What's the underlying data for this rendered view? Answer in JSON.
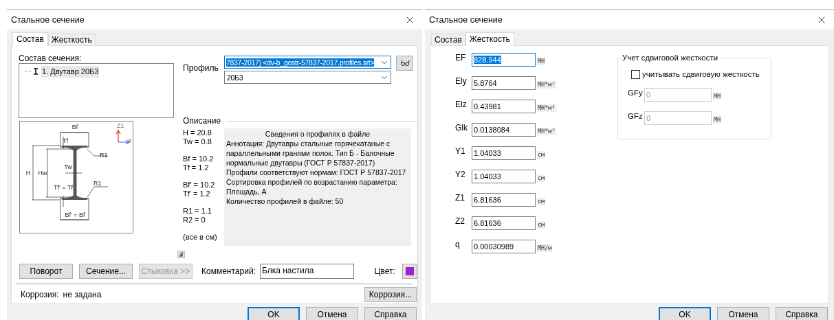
{
  "composition_dialog": {
    "title": "Стальное сечение",
    "tabs": [
      {
        "label": "Состав",
        "selected": true
      },
      {
        "label": "Жесткость",
        "selected": false
      }
    ],
    "section_label": "Состав сечения:",
    "tree": [
      {
        "label": "1. Двутавр 20Б3",
        "selected": true
      }
    ],
    "profile_label": "Профиль",
    "profile_file": {
      "value": "7837-2017) <dv-b_gostr-57837-2017.profiles.srt>",
      "focused": true
    },
    "profile_size": {
      "value": "20Б3",
      "focused": false
    },
    "drawing_labels": [
      {
        "text": "Bf"
      },
      {
        "text": "Tf"
      },
      {
        "text": "R1"
      },
      {
        "text": "H"
      },
      {
        "text": "Hw"
      },
      {
        "text": "Tw"
      },
      {
        "text": "Tf' = Tf"
      },
      {
        "text": "R1"
      },
      {
        "text": "Bf' = Bf"
      },
      {
        "text": "Z1"
      },
      {
        "text": "Y"
      }
    ],
    "description_label": "Описание",
    "param_groups": [
      [
        "H = 20.8",
        "Tw = 0.8"
      ],
      [
        "Bf = 10.2",
        "Tf = 1.2"
      ],
      [
        "Bf' = 10.2",
        "Tf' = 1.2"
      ],
      [
        "R1 = 1.1",
        "R2 = 0"
      ],
      [
        "(все в см)"
      ]
    ],
    "info": {
      "title": "Сведения о профилях в файле",
      "lines": [
        "Аннотация: Двутавры стальные горячекатаные с параллельными гранями полок. Тип Б - Балочные нормальные двутавры (ГОСТ Р 57837-2017)",
        "Профили соответствуют нормам: ГОСТ Р 57837-2017",
        "Сортировка профилей по возрастанию параметра: Площадь, А",
        "Количество профилей в файле: 50"
      ]
    },
    "action_buttons": [
      {
        "label": "Поворот",
        "disabled": false
      },
      {
        "label": "Сечение...",
        "disabled": false
      },
      {
        "label": "Стыковка >>",
        "disabled": true
      }
    ],
    "comment_label": "Комментарий:",
    "comment_value": "Блка настила",
    "color_label": "Цвет:",
    "color": "#a31fd0",
    "corrosion_label": "Коррозия:",
    "corrosion_value": "не задана",
    "corrosion_button": "Коррозия...",
    "footer_buttons": [
      {
        "label": "OK",
        "default": true
      },
      {
        "label": "Отмена",
        "default": false
      },
      {
        "label": "Справка",
        "default": false
      }
    ]
  },
  "stiffness_dialog": {
    "title": "Стальное сечение",
    "tabs": [
      {
        "label": "Состав",
        "selected": false
      },
      {
        "label": "Жесткость",
        "selected": true
      }
    ],
    "rows": [
      {
        "label": "EF",
        "value": "828.944",
        "unit": "МН",
        "focused": true
      },
      {
        "label": "Ely",
        "value": "5.8764",
        "unit": "МН*м²",
        "focused": false
      },
      {
        "label": "Elz",
        "value": "0.43981",
        "unit": "МН*м²",
        "focused": false
      },
      {
        "label": "Glk",
        "value": "0.0138084",
        "unit": "МН*м²",
        "focused": false
      },
      {
        "label": "Y1",
        "value": "1.04033",
        "unit": "см",
        "focused": false
      },
      {
        "label": "Y2",
        "value": "1.04033",
        "unit": "см",
        "focused": false
      },
      {
        "label": "Z1",
        "value": "6.81636",
        "unit": "см",
        "focused": false
      },
      {
        "label": "Z2",
        "value": "6.81636",
        "unit": "см",
        "focused": false
      },
      {
        "label": "q",
        "value": "0.00030989",
        "unit": "МН/м",
        "focused": false
      }
    ],
    "shear_group": {
      "title": "Учет сдвиговой жесткости",
      "checkbox": {
        "label": "учитывать сдвиговую жесткость",
        "checked": false
      },
      "fields": [
        {
          "label": "GFy",
          "value": "0",
          "unit": "МН",
          "disabled": true
        },
        {
          "label": "GFz",
          "value": "0",
          "unit": "МН",
          "disabled": true
        }
      ]
    },
    "footer_buttons": [
      {
        "label": "OK",
        "default": true
      },
      {
        "label": "Отмена",
        "default": false
      },
      {
        "label": "Справка",
        "default": false
      }
    ]
  }
}
